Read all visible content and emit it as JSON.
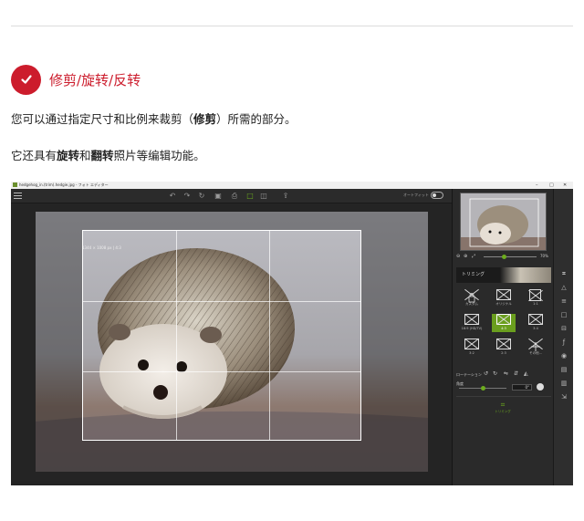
{
  "section": {
    "title": "修剪/旋转/反转",
    "para1": {
      "a": "您可以通过指定尺寸和比例来裁剪（",
      "b": "修剪",
      "c": "）所需的部分。"
    },
    "para2": {
      "a": "它还具有",
      "b": "旋转",
      "c": "和",
      "d": "翻转",
      "e": "照片等编辑功能。"
    }
  },
  "app": {
    "window_title": "hedgehog_in.(trim).hedgie.jpg - フォト エディター",
    "window_controls": {
      "minimize": "–",
      "maximize": "□",
      "close": "✕"
    },
    "toolbar": {
      "undo": "↶",
      "redo": "↷",
      "rotate": "↻",
      "save": "▣",
      "print": "⎙",
      "single_view": "□",
      "compare_view": "◫",
      "share": "⇪"
    },
    "auto_fit_label": "オートフィット",
    "crop_size_label": "1344 × 1008 px | 4:3",
    "zoom_label": "70%",
    "trim_label": "トリミング",
    "ratios": [
      {
        "label": "カスタム",
        "icon": "lock-icon"
      },
      {
        "label": "オリジナル",
        "icon": "original-icon"
      },
      {
        "label": "1:1",
        "icon": "ratio-icon"
      },
      {
        "label": "16:9 (HD/TV)",
        "icon": "ratio-icon"
      },
      {
        "label": "4:3",
        "icon": "ratio-icon"
      },
      {
        "label": "3:4",
        "icon": "ratio-icon"
      },
      {
        "label": "3:2",
        "icon": "ratio-icon"
      },
      {
        "label": "2:3",
        "icon": "ratio-icon"
      },
      {
        "label": "その他...",
        "icon": "plus-icon"
      }
    ],
    "rotation_label": "ローテーション",
    "angle_label": "角度",
    "angle_value": "0°",
    "apply_label": "トリミング"
  }
}
